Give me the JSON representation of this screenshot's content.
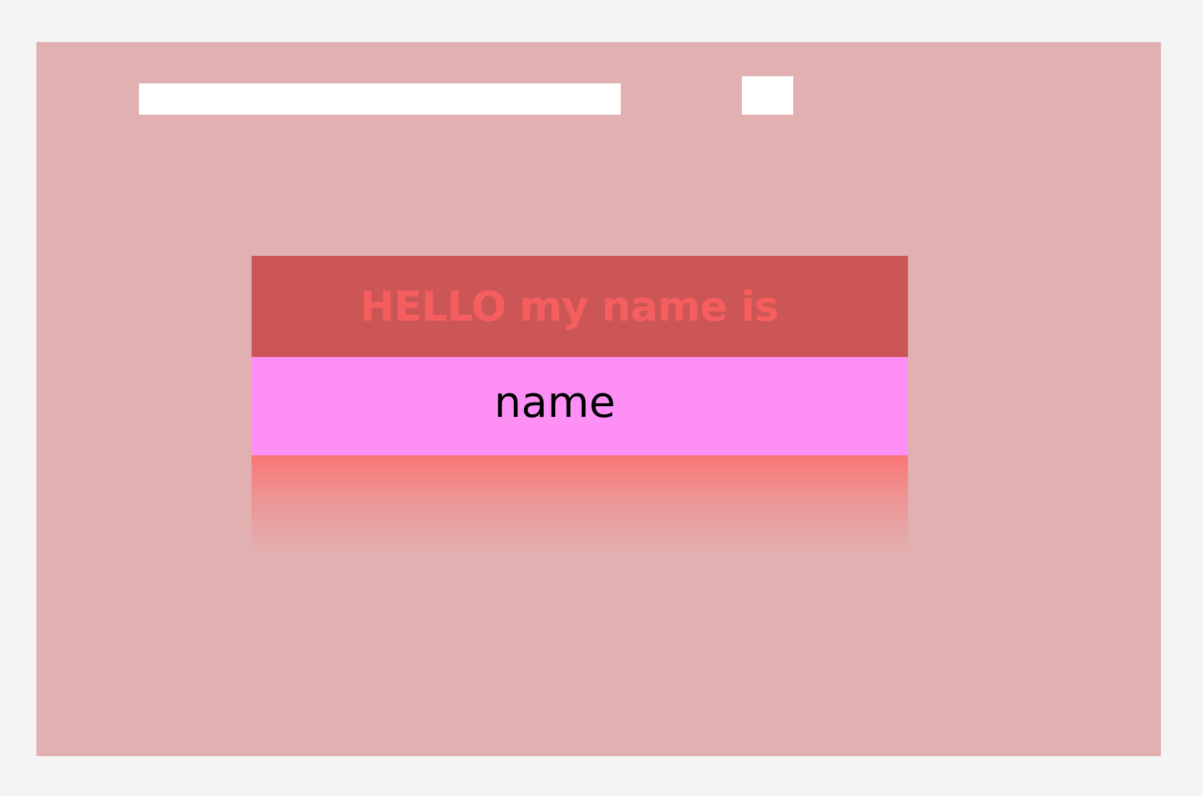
{
  "form": {
    "input_value": "",
    "input_placeholder": "",
    "button_label": ""
  },
  "name_tag": {
    "header": "HELLO my name is",
    "name": "name"
  },
  "colors": {
    "page_background": "#f4f4f4",
    "panel_background": "#e2b0b0",
    "header_background": "#cc5555",
    "header_text": "#f55e5e",
    "name_band": "#fd8ff5",
    "fade_top": "#fb7676"
  }
}
